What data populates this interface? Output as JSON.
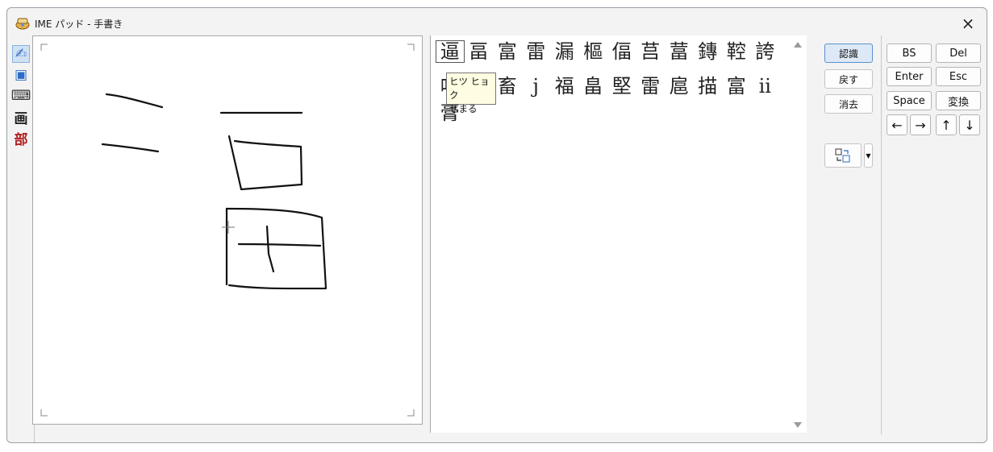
{
  "window": {
    "title": "IME パッド - 手書き",
    "close_glyph": "×"
  },
  "toolstrip": {
    "tools": [
      {
        "name": "handwriting",
        "glyph": "✍"
      },
      {
        "name": "character-list",
        "glyph": "▣"
      },
      {
        "name": "soft-keyboard",
        "glyph": "⌨"
      },
      {
        "name": "stroke-count",
        "glyph": "画"
      },
      {
        "name": "radical",
        "glyph": "部"
      }
    ]
  },
  "candidates": {
    "row1": [
      "逼",
      "畐",
      "富",
      "雷",
      "漏",
      "樞",
      "偪",
      "莒",
      "葍",
      "鏄",
      "鞚",
      "誇"
    ],
    "row2": [
      "呾",
      "",
      "畜",
      "j",
      "福",
      "畠",
      "堅",
      "雷",
      "扈",
      "描",
      "富",
      "ii"
    ],
    "row3": [
      "膏"
    ]
  },
  "tooltip": {
    "text": "ヒツ ヒョク\nせまる"
  },
  "controls": {
    "recognize": "認識",
    "undo": "戻す",
    "clear": "消去"
  },
  "keys": {
    "bs": "BS",
    "del": "Del",
    "enter": "Enter",
    "esc": "Esc",
    "space": "Space",
    "convert": "変換",
    "left": "←",
    "right": "→",
    "up": "↑",
    "down": "↓"
  }
}
